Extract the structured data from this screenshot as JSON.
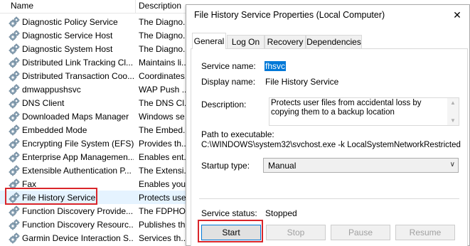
{
  "services": {
    "columns": {
      "name": "Name",
      "description": "Description"
    },
    "rows": [
      {
        "name": "Diagnostic Policy Service",
        "desc": "The Diagno..."
      },
      {
        "name": "Diagnostic Service Host",
        "desc": "The Diagno..."
      },
      {
        "name": "Diagnostic System Host",
        "desc": "The Diagno..."
      },
      {
        "name": "Distributed Link Tracking Cl...",
        "desc": "Maintains li..."
      },
      {
        "name": "Distributed Transaction Coo...",
        "desc": "Coordinates..."
      },
      {
        "name": "dmwappushsvc",
        "desc": "WAP Push ..."
      },
      {
        "name": "DNS Client",
        "desc": "The DNS Cl..."
      },
      {
        "name": "Downloaded Maps Manager",
        "desc": "Windows se..."
      },
      {
        "name": "Embedded Mode",
        "desc": "The Embed..."
      },
      {
        "name": "Encrypting File System (EFS)",
        "desc": "Provides th..."
      },
      {
        "name": "Enterprise App Managemen...",
        "desc": "Enables ent..."
      },
      {
        "name": "Extensible Authentication P...",
        "desc": "The Extensi..."
      },
      {
        "name": "Fax",
        "desc": "Enables you..."
      },
      {
        "name": "File History Service",
        "desc": "Protects use..."
      },
      {
        "name": "Function Discovery Provide...",
        "desc": "The FDPHO..."
      },
      {
        "name": "Function Discovery Resourc...",
        "desc": "Publishes th..."
      },
      {
        "name": "Garmin Device Interaction S...",
        "desc": "Services th..."
      }
    ],
    "selected_index": 13
  },
  "dialog": {
    "title": "File History Service Properties (Local Computer)",
    "close_glyph": "✕",
    "tabs": [
      "General",
      "Log On",
      "Recovery",
      "Dependencies"
    ],
    "active_tab": "General",
    "labels": {
      "service_name": "Service name:",
      "display_name": "Display name:",
      "description": "Description:",
      "path": "Path to executable:",
      "startup_type": "Startup type:",
      "service_status": "Service status:"
    },
    "values": {
      "service_name": "fhsvc",
      "display_name": "File History Service",
      "description": "Protects user files from accidental loss by copying them to a backup location",
      "path": "C:\\WINDOWS\\system32\\svchost.exe -k LocalSystemNetworkRestricted",
      "startup_type": "Manual",
      "service_status": "Stopped"
    },
    "buttons": {
      "start": "Start",
      "stop": "Stop",
      "pause": "Pause",
      "resume": "Resume"
    }
  },
  "colors": {
    "highlight": "#d9262b",
    "selection": "#0078d7",
    "row_selected": "#e5f3ff"
  }
}
